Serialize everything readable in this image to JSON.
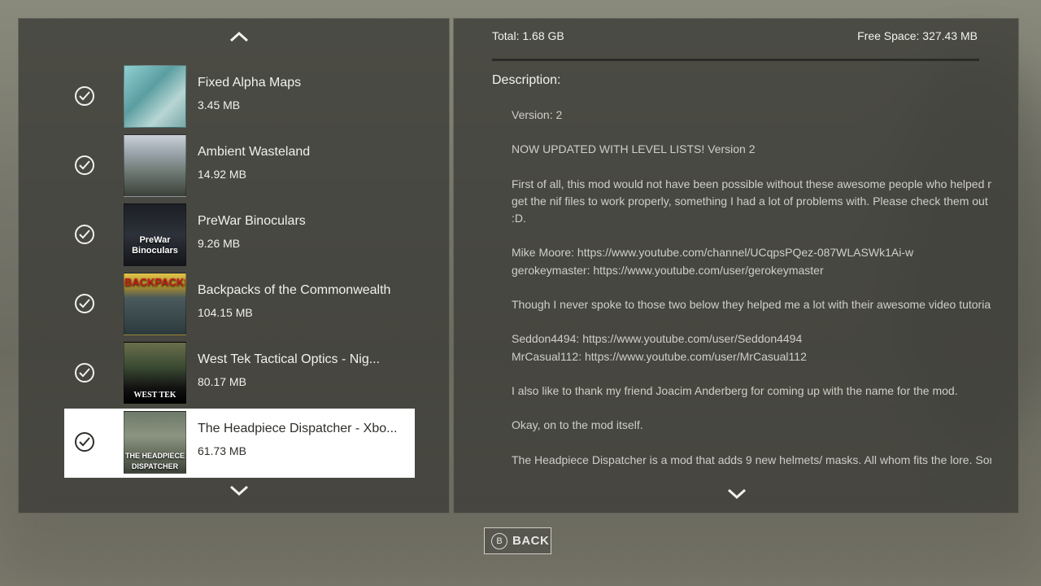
{
  "mods": [
    {
      "name": "Fixed Alpha Maps",
      "size": "3.45 MB",
      "checked": true,
      "thumb_icon": "bottle-shelf-thumbnail"
    },
    {
      "name": "Ambient Wasteland",
      "size": "14.92 MB",
      "checked": true,
      "thumb_icon": "wasteland-landscape-thumbnail"
    },
    {
      "name": "PreWar Binoculars",
      "size": "9.26 MB",
      "checked": true,
      "thumb_icon": "binoculars-thumbnail",
      "thumb_text": "PreWar Binoculars"
    },
    {
      "name": "Backpacks of the Commonwealth",
      "size": "104.15 MB",
      "checked": true,
      "thumb_icon": "backpacks-thumbnail",
      "thumb_text": "BACKPACKS"
    },
    {
      "name": "West Tek Tactical Optics - Nig...",
      "size": "80.17 MB",
      "checked": true,
      "thumb_icon": "night-vision-thumbnail",
      "thumb_text": "WEST TEK"
    },
    {
      "name": "The Headpiece Dispatcher - Xbo...",
      "size": "61.73 MB",
      "checked": true,
      "selected": true,
      "thumb_icon": "headpiece-thumbnail",
      "thumb_text": "THE HEADPIECE DISPATCHER"
    }
  ],
  "storage": {
    "total": "Total: 1.68 GB",
    "free": "Free Space: 327.43 MB"
  },
  "description": {
    "heading": "Description:",
    "lines": [
      "Version: 2",
      "",
      "NOW UPDATED WITH LEVEL LISTS! Version 2",
      "",
      "First of all, this mod would not have been possible without these awesome people who helped me",
      "get the nif files to work properly, something I had a lot of problems with. Please check them out",
      ":D.",
      "",
      "Mike Moore: https://www.youtube.com/channel/UCqpsPQez-087WLASWk1Ai-w",
      "gerokeymaster: https://www.youtube.com/user/gerokeymaster",
      "",
      "Though I never spoke to those two below they helped me a lot with their awesome video tutorials.",
      "",
      "Seddon4494: https://www.youtube.com/user/Seddon4494",
      "MrCasual112: https://www.youtube.com/user/MrCasual112",
      "",
      "I also like to thank my friend Joacim Anderberg for coming up with the name for the mod.",
      "",
      "Okay, on to the mod itself.",
      "",
      "The Headpiece Dispatcher is a mod that adds 9 new helmets/ masks. All whom fits the lore. Some"
    ]
  },
  "back_button": {
    "icon_label": "B",
    "label": "BACK"
  },
  "colors": {
    "panel": "#3e3e39",
    "selected_row": "#ffffff",
    "text": "#f1f1ec",
    "desc_text": "#cfcfc8"
  }
}
